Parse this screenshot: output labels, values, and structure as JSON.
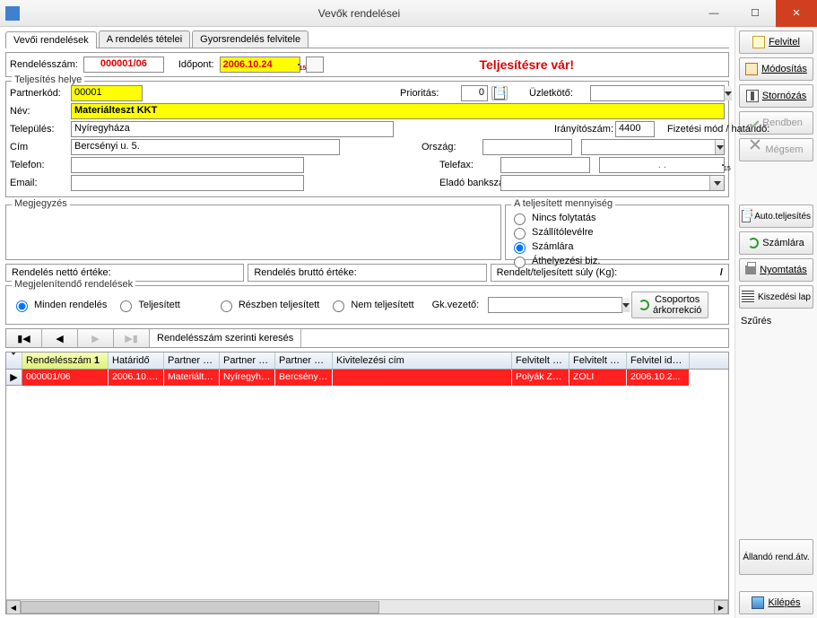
{
  "window": {
    "title": "Vevők rendelései"
  },
  "tabs": [
    "Vevői rendelések",
    "A rendelés tételei",
    "Gyorsrendelés felvitele"
  ],
  "header": {
    "order_no_label": "Rendelésszám:",
    "order_no": "000001/06",
    "date_label": "Időpont:",
    "date": "2006.10.24",
    "status": "Teljesítésre vár!"
  },
  "delivery": {
    "legend": "Teljesítés helye",
    "partner_code_label": "Partnerkód:",
    "partner_code": "00001",
    "priority_label": "Prioritás:",
    "priority": "0",
    "salesperson_label": "Üzletkötő:",
    "salesperson": "",
    "name_label": "Név:",
    "name": "Materiálteszt KKT",
    "city_label": "Település:",
    "city": "Nyíregyháza",
    "zip_label": "Irányítószám:",
    "zip": "4400",
    "payment_label": "Fizetési mód / határidő:",
    "address_label": "Cím",
    "address": "Bercsényi u. 5.",
    "country_label": "Ország:",
    "country": "",
    "phone_label": "Telefon:",
    "phone": "",
    "fax_label": "Telefax:",
    "fax": "",
    "dotted": ". .",
    "email_label": "Email:",
    "email": "",
    "bank_label": "Eladó bankszámla:",
    "bank": ""
  },
  "notes": {
    "legend": "Megjegyzés"
  },
  "fulfilled_qty": {
    "legend": "A teljesített mennyiség",
    "options": [
      "Nincs folytatás",
      "Szállítólevélre",
      "Számlára",
      "Áthelyezési biz."
    ],
    "selected": 2
  },
  "totals": {
    "net_label": "Rendelés nettó értéke:",
    "gross_label": "Rendelés bruttó értéke:",
    "weight_label": "Rendelt/teljesített súly (Kg):",
    "weight_sep": "/"
  },
  "orders_filter": {
    "legend": "Megjelenítendő rendelések",
    "all": "Minden rendelés",
    "done": "Teljesített",
    "partial": "Részben teljesített",
    "not_done": "Nem teljesített",
    "driver_label": "Gk.vezető:",
    "driver": "",
    "bulk_btn_l1": "Csoportos",
    "bulk_btn_l2": "árkorrekció"
  },
  "nav": {
    "search_label": "Rendelésszám szerinti keresés",
    "search_value": ""
  },
  "table": {
    "columns": [
      "Rendelésszám",
      "Határidő",
      "Partner név",
      "Partner vá...",
      "Partner cím",
      "Kivitelezési cím",
      "Felvitelt vé...",
      "Felvitelt vé...",
      "Felvitel idő..."
    ],
    "sort_col": 0,
    "rows": [
      {
        "cells": [
          "000001/06",
          "2006.10.24.",
          "Materiáltes...",
          "Nyíregyháza",
          "Bercsényi ...",
          "",
          "Polyák Zolt...",
          "ZOLI",
          "2006.10.2..."
        ],
        "selected": true
      }
    ]
  },
  "sidebar": {
    "felvitel": "Felvitel",
    "modositas": "Módosítás",
    "stornozas": "Stornózás",
    "rendben": "Rendben",
    "megsem": "Mégsem",
    "auto": "Auto.teljesítés",
    "szamlara": "Számlára",
    "nyomtatas": "Nyomtatás",
    "kiszedesi": "Kiszedési lap",
    "szures": "Szűrés",
    "allando": "Állandó rend.átv.",
    "kilepes": "Kilépés"
  }
}
